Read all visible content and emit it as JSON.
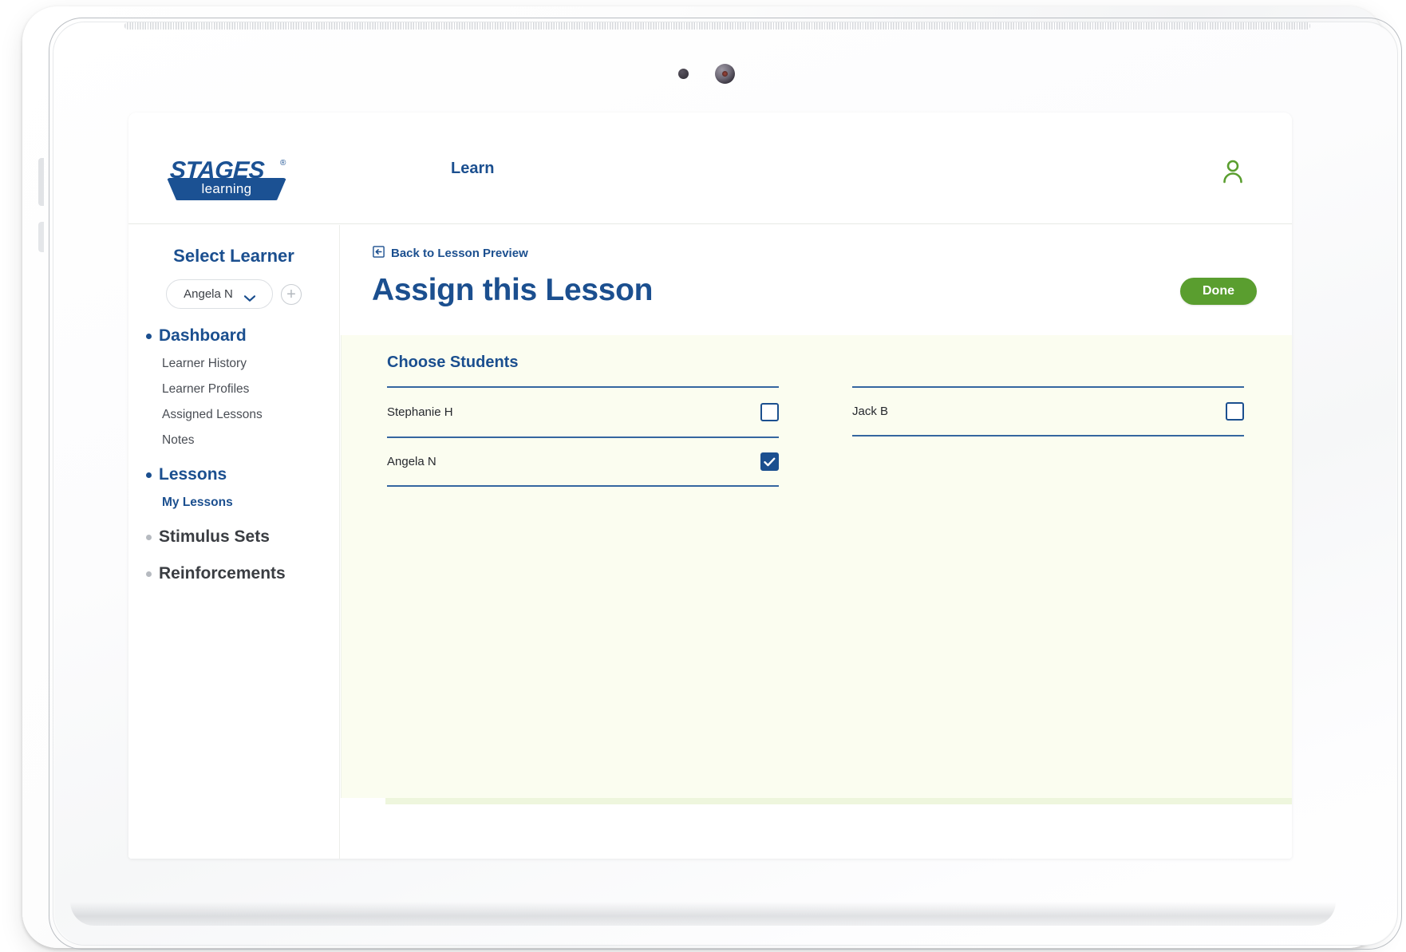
{
  "device": {
    "type": "tablet",
    "icons": {
      "sensor": "sensor-dot",
      "camera": "camera-lens",
      "speaker": "speaker-grille"
    }
  },
  "colors": {
    "brand_blue": "#1b4f8f",
    "accent_green": "#5a9e2f",
    "panel_bg": "#fbfdf0",
    "tab_underline": "#a8d3f0"
  },
  "header": {
    "logo": {
      "name": "STAGES",
      "registered": "®",
      "sub": "learning"
    },
    "nav_tabs": [
      {
        "label": "Learn",
        "active": true
      }
    ],
    "account_icon": "user-icon"
  },
  "sidebar": {
    "title": "Select Learner",
    "learner_select": {
      "value": "Angela N",
      "icon": "chevron-down-icon"
    },
    "add_learner": {
      "icon": "plus-icon",
      "label": "+"
    },
    "groups": [
      {
        "label": "Dashboard",
        "active": true,
        "items": [
          {
            "label": "Learner History",
            "selected": false
          },
          {
            "label": "Learner Profiles",
            "selected": false
          },
          {
            "label": "Assigned Lessons",
            "selected": false
          },
          {
            "label": "Notes",
            "selected": false
          }
        ]
      },
      {
        "label": "Lessons",
        "active": true,
        "items": [
          {
            "label": "My Lessons",
            "selected": true
          }
        ]
      },
      {
        "label": "Stimulus Sets",
        "active": false,
        "items": []
      },
      {
        "label": "Reinforcements",
        "active": false,
        "items": []
      }
    ]
  },
  "main": {
    "back_link": {
      "label": "Back to Lesson Preview",
      "icon": "back-arrow-box-icon"
    },
    "title": "Assign this Lesson",
    "done_button": "Done",
    "panel": {
      "section_title": "Choose Students",
      "students": [
        {
          "name": "Stephanie H",
          "checked": false
        },
        {
          "name": "Jack B",
          "checked": false
        },
        {
          "name": "Angela N",
          "checked": true
        }
      ]
    }
  }
}
